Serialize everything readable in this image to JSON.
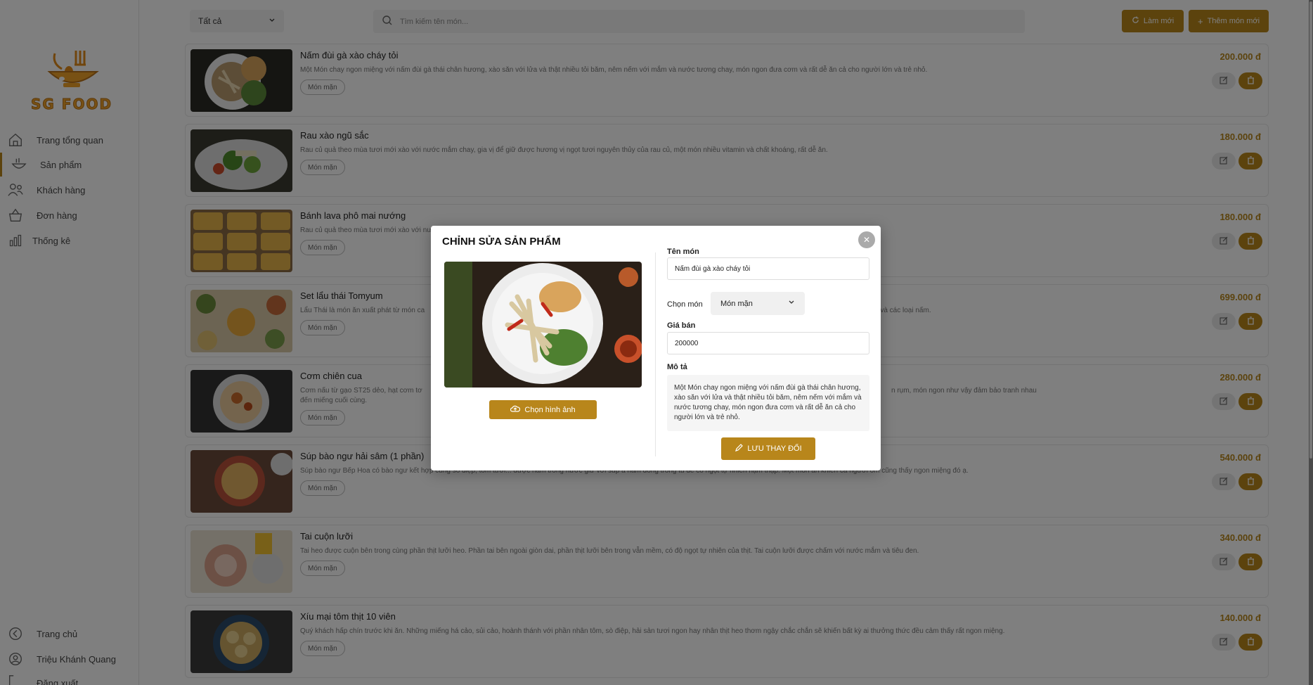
{
  "brand": {
    "logo_text": "SG FOOD"
  },
  "sidebar": {
    "items": [
      {
        "label": "Trang tổng quan",
        "icon": "home-icon"
      },
      {
        "label": "Sản phẩm",
        "icon": "bowl-icon",
        "active": true
      },
      {
        "label": "Khách hàng",
        "icon": "users-icon"
      },
      {
        "label": "Đơn hàng",
        "icon": "basket-icon"
      },
      {
        "label": "Thống kê",
        "icon": "chart-icon"
      }
    ],
    "bottom": [
      {
        "label": "Trang chủ",
        "icon": "back-circle-icon"
      },
      {
        "label": "Triệu Khánh Quang",
        "icon": "user-circle-icon"
      },
      {
        "label": "Đăng xuất",
        "icon": "logout-icon"
      }
    ]
  },
  "toolbar": {
    "filter_value": "Tất cả",
    "search_placeholder": "Tìm kiếm tên món...",
    "refresh_label": "Làm mới",
    "add_label": "Thêm món mới"
  },
  "products": [
    {
      "name": "Nấm đùi gà xào cháy tỏi",
      "desc": "Một Món chay ngon miệng với nấm đùi gà thái chân hương, xào săn với lửa và thật nhiều tỏi băm, nêm nếm với mắm và nước tương chay, món ngon đưa cơm và rất dễ ăn cả cho người lớn và trẻ nhỏ.",
      "tag": "Món mặn",
      "price": "200.000 đ"
    },
    {
      "name": "Rau xào ngũ sắc",
      "desc": "Rau củ quả theo mùa tươi mới xào với nước mắm chay, gia vị để giữ được hương vị ngọt tươi nguyên thủy của rau củ, một món nhiều vitamin và chất khoáng, rất dễ ăn.",
      "tag": "Món mặn",
      "price": "180.000 đ"
    },
    {
      "name": "Bánh lava phô mai nướng",
      "desc": "Rau củ quả theo mùa tươi mới xào với nư",
      "tag": "Món mặn",
      "price": "180.000 đ"
    },
    {
      "name": "Set lẩu thái Tomyum",
      "desc": "Lẩu Thái là món ăn xuất phát từ món ca",
      "desc_right": "n và các loại nấm.",
      "tag": "Món mặn",
      "price": "699.000 đ"
    },
    {
      "name": "Cơm chiên cua",
      "desc": "Cơm nấu từ gạo ST25 dẻo, hạt cơm tơ",
      "desc_right": "n rụm, món ngon như vậy đảm bảo tranh nhau",
      "desc2": "đến miếng cuối cùng.",
      "tag": "Món mặn",
      "price": "280.000 đ"
    },
    {
      "name": "Súp bào ngư hải sâm (1 phần)",
      "desc": "Súp bào ngư Bếp Hoa có bào ngư kết hợp cùng sò điệp, tôm tươi... được nấm trong nước giữ với súp á nấm đông trong tủ để có ngọt tự nhiên hậm thập. Một món ăn khiến cả người ốm cũng thấy ngon miệng đó ạ.",
      "tag": "Món mặn",
      "price": "540.000 đ"
    },
    {
      "name": "Tai cuộn lưỡi",
      "desc": "Tai heo được cuộn bên trong cùng phần thịt lưỡi heo. Phần tai bên ngoài giòn dai, phần thịt lưỡi bên trong vẫn mềm, có độ ngọt tự nhiên của thịt. Tai cuộn lưỡi được chấm với nước mắm và tiêu đen.",
      "tag": "Món mặn",
      "price": "340.000 đ"
    },
    {
      "name": "Xíu mại tôm thịt 10 viên",
      "desc": "Quý khách hấp chín trước khi ăn. Những miếng há cảo, sủi cảo, hoành thánh với phần nhân tôm, sò điệp, hải sản tươi ngon hay nhân thịt heo thơm ngậy chắc chắn sẽ khiến bất kỳ ai thưởng thức đều cảm thấy rất ngon miệng.",
      "tag": "Món mặn",
      "price": "140.000 đ"
    }
  ],
  "modal": {
    "title": "CHỈNH SỬA SẢN PHẨM",
    "choose_image_label": "Chọn hình ảnh",
    "name_label": "Tên món",
    "name_value": "Nấm đùi gà xào cháy tỏi",
    "category_label": "Chọn món",
    "category_value": "Món mặn",
    "price_label": "Giá bán",
    "price_value": "200000",
    "desc_label": "Mô tả",
    "desc_value": "Một Món chay ngon miệng với nấm đùi gà thái chân hương, xào săn với lửa và thật nhiều tỏi băm, nêm nếm với mắm và nước tương chay, món ngon đưa cơm và rất dễ ăn cả cho người lớn và trẻ nhỏ.",
    "save_label": "LƯU THAY ĐỔI"
  },
  "colors": {
    "accent": "#b8861b",
    "overlay": "rgba(0,0,0,0.5)"
  }
}
